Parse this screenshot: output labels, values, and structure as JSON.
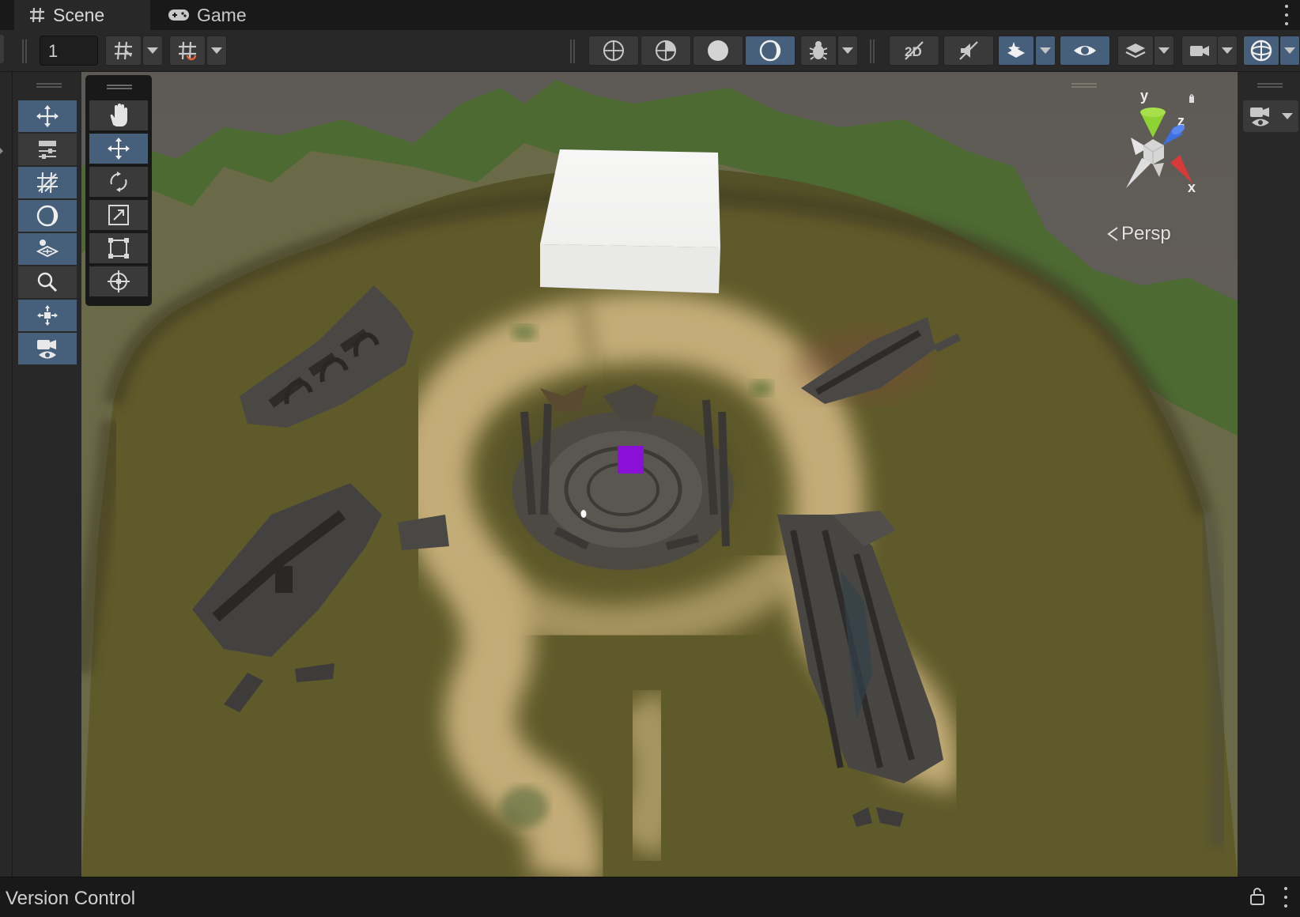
{
  "tabs": [
    {
      "label": "Scene",
      "icon": "grid-hash-icon",
      "active": true
    },
    {
      "label": "Game",
      "icon": "gamepad-icon",
      "active": false
    }
  ],
  "toolbar": {
    "grid_size_value": "1",
    "buttons": [
      "grid-snap-icon",
      "grid-visibility-icon",
      "wireframe-shading-icon",
      "shaded-wireframe-icon",
      "shaded-icon",
      "lit-shading-icon",
      "debug-draw-icon",
      "2d-mode-icon",
      "audio-mute-icon",
      "effects-icon",
      "visibility-icon",
      "layers-icon",
      "camera-settings-icon",
      "gizmos-icon"
    ]
  },
  "left_panel": {
    "tools": [
      "move-icon",
      "transform-settings-icon",
      "grid-icon",
      "sphere-icon",
      "layers-stack-icon",
      "zoom-icon",
      "pivot-icon",
      "camera-icon"
    ]
  },
  "tool_panel": {
    "tools": [
      "hand-tool-icon",
      "move-tool-icon",
      "rotate-tool-icon",
      "scale-tool-icon",
      "rect-tool-icon",
      "transform-tool-icon"
    ],
    "active_tool": "move-tool-icon"
  },
  "gizmo": {
    "axis_y": "y",
    "axis_z": "z",
    "axis_x": "x",
    "projection_label": "Persp",
    "colors": {
      "y": "#8ed234",
      "z": "#3e6fe0",
      "x": "#d83a3a"
    }
  },
  "status": {
    "text": "Version Control"
  }
}
